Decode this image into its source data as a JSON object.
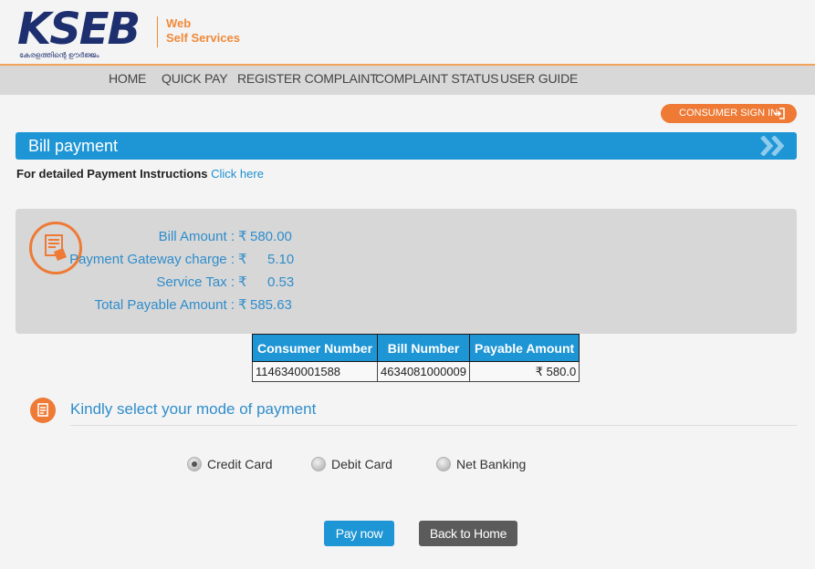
{
  "brand": {
    "logo_text": "KSEB",
    "logo_tagline": "കേരളത്തിന്റെ ഊർജ്ജം",
    "web_line1": "Web",
    "web_line2": "Self Services"
  },
  "nav": {
    "items": [
      "HOME",
      "QUICK PAY",
      "REGISTER COMPLAINT",
      "COMPLAINT STATUS",
      "USER GUIDE"
    ]
  },
  "signin": {
    "label": "CONSUMER SIGN IN"
  },
  "page": {
    "title": "Bill payment",
    "instructions_text": "For detailed Payment Instructions",
    "instructions_link": "Click here"
  },
  "amounts": {
    "rows": [
      {
        "label": "Bill Amount :",
        "currency": "₹",
        "value": "580.00"
      },
      {
        "label": "Payment Gateway charge :",
        "currency": "₹",
        "value": "5.10"
      },
      {
        "label": "Service Tax :",
        "currency": "₹",
        "value": "0.53"
      },
      {
        "label": "Total Payable Amount :",
        "currency": "₹",
        "value": "585.63"
      }
    ]
  },
  "table": {
    "headers": [
      "Consumer Number",
      "Bill Number",
      "Payable Amount"
    ],
    "row": {
      "consumer_number": "1146340001588",
      "bill_number": "4634081000009",
      "payable_amount": "₹ 580.0"
    }
  },
  "payment_mode": {
    "title": "Kindly select your mode of payment",
    "options": [
      "Credit Card",
      "Debit Card",
      "Net Banking"
    ],
    "selected": "Credit Card"
  },
  "buttons": {
    "pay_now": "Pay now",
    "back_home": "Back to Home"
  },
  "colors": {
    "accent": "#1e95d4",
    "orange": "#ee7a35",
    "brand_navy": "#1d2f6f"
  }
}
